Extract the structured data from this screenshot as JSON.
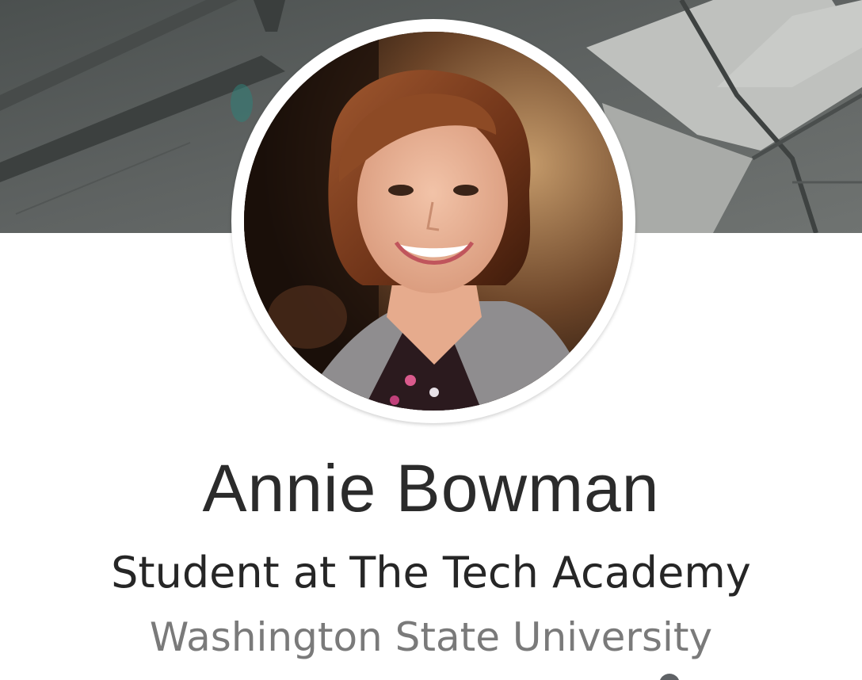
{
  "profile": {
    "name": "Annie Bowman",
    "headline": "Student at The Tech Academy",
    "school": "Washington State University"
  },
  "icons": {
    "cover": "cover-photo",
    "avatar": "profile-photo",
    "partial": "location-pin-icon"
  },
  "colors": {
    "name_text": "#2b2b2b",
    "headline_text": "#262626",
    "school_text": "#7a7a7a",
    "avatar_border": "#ffffff"
  }
}
